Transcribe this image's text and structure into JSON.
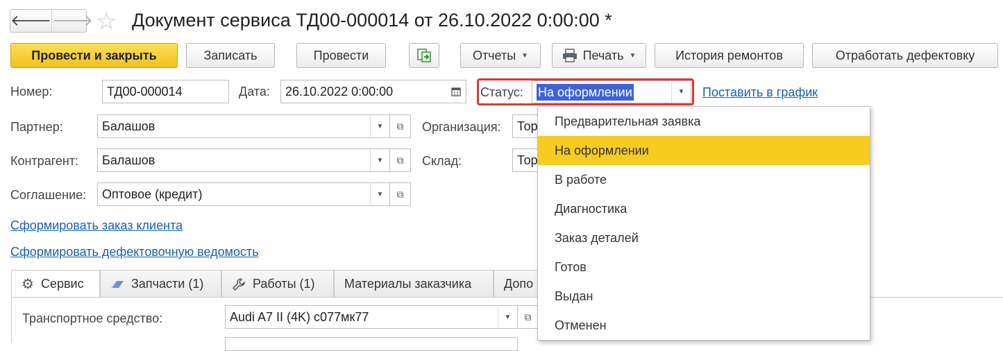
{
  "header": {
    "back_arrow": "🡐",
    "forward_arrow": "🡒",
    "star": "☆",
    "title": "Документ сервиса ТД00-000014 от 26.10.2022 0:00:00 *"
  },
  "toolbar": {
    "post_close": "Провести и закрыть",
    "save": "Записать",
    "post": "Провести",
    "reports": "Отчеты",
    "print": "Печать",
    "repair_history": "История ремонтов",
    "process_defects": "Отработать дефектовку"
  },
  "form": {
    "number_label": "Номер:",
    "number_value": "ТД00-000014",
    "date_label": "Дата:",
    "date_value": "26.10.2022  0:00:00",
    "status_label": "Статус:",
    "status_value": "На оформлении",
    "schedule_link": "Поставить в график",
    "partner_label": "Партнер:",
    "partner_value": "Балашов",
    "org_label": "Организация:",
    "org_value": "Тор",
    "contractor_label": "Контрагент:",
    "contractor_value": "Балашов",
    "warehouse_label": "Склад:",
    "warehouse_value": "Тор",
    "agreement_label": "Соглашение:",
    "agreement_value": "Оптовое (кредит)",
    "link_client_order": "Сформировать заказ клиента",
    "link_defect_sheet": "Сформировать дефектовочную ведомость"
  },
  "tabs": [
    {
      "label": "Сервис"
    },
    {
      "label": "Запчасти (1)"
    },
    {
      "label": "Работы (1)"
    },
    {
      "label": "Материалы заказчика"
    },
    {
      "label": "Допо"
    }
  ],
  "service": {
    "vehicle_label": "Транспортное средство:",
    "vehicle_value": "Audi A7 II (4K) с077мк77"
  },
  "status_dropdown": {
    "selected_index": 1,
    "options": [
      "Предварительная заявка",
      "На оформлении",
      "В работе",
      "Диагностика",
      "Заказ деталей",
      "Готов",
      "Выдан",
      "Отменен"
    ]
  },
  "colors": {
    "primary_button": "#f1c21b",
    "status_highlight_border": "#d93a33",
    "selected_option": "#f8cb22",
    "link": "#1a5fb4",
    "selection": "#3d63d6"
  }
}
